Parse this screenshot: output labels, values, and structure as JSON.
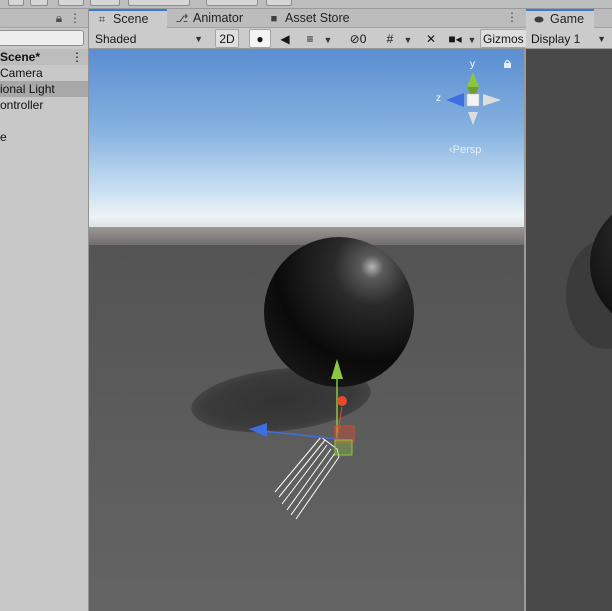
{
  "hierarchy": {
    "lock_icon": "lock-icon",
    "menu_icon": "more-vert-icon",
    "scene_name": "Scene*",
    "items": [
      {
        "label": "Camera"
      },
      {
        "label": "ional Light",
        "selected": true
      },
      {
        "label": "ontroller"
      },
      {
        "label": ""
      },
      {
        "label": "e"
      }
    ]
  },
  "scene_window": {
    "tabs": [
      {
        "label": "Scene",
        "icon": "grid-icon",
        "active": true
      },
      {
        "label": "Animator",
        "icon": "animator-icon"
      },
      {
        "label": "Asset Store",
        "icon": "store-bag-icon"
      }
    ],
    "toolbar": {
      "draw_mode": "Shaded",
      "mode_2d": "2D",
      "hidden_count": "0",
      "gizmos_label": "Gizmos"
    },
    "gizmo": {
      "axis_y": "y",
      "axis_z": "z",
      "projection": "Persp",
      "axis_colors": {
        "x": "#e84a2e",
        "y": "#8dc63f",
        "z": "#3d6fe0"
      }
    }
  },
  "game_window": {
    "tab_label": "Game",
    "display": "Display 1"
  },
  "colors": {
    "accent": "#3a79d9",
    "panel": "#c8c8c8",
    "sky_top": "#5b8fd3",
    "ground": "#5e5e5e"
  }
}
